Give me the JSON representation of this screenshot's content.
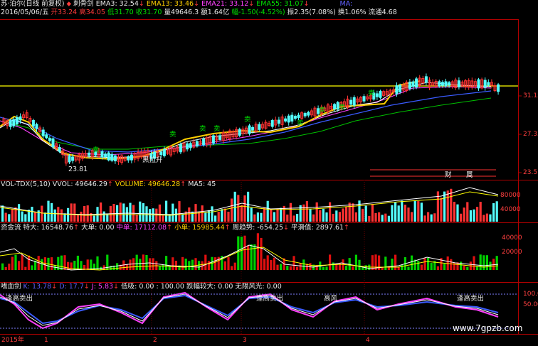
{
  "header": {
    "name": "苏·泊尔(日线 前复权)",
    "ma_label": "刺骨剑",
    "ema3": "EMA3: 32.54",
    "ema13": "EMA13: 33.46",
    "ema21": "EMA21: 33.12",
    "ema55": "EMA55: 31.07",
    "ma": "MA:",
    "date": "2016/05/06/五",
    "open": "开33.24",
    "high": "高34.05",
    "low": "低31.70",
    "close": "收31.70",
    "vol": "量49646.3",
    "amt": "额1.64亿",
    "amp": "幅-1.50(-4.52%)",
    "swing": "振2.35(7.08%)",
    "turn": "换1.06%",
    "float": "流通4.68"
  },
  "main_axis": {
    "ticks": [
      "31.15",
      "27.33",
      "23.51"
    ]
  },
  "main_labels": {
    "low_price": "23.81",
    "inflow": "黑拉升",
    "buy_marks": [
      "卖",
      "卖",
      "卖",
      "卖",
      "卖",
      "卖",
      "卖",
      "卖",
      "卖"
    ],
    "fin": "财",
    "pow": "属"
  },
  "vol_panel": {
    "title": "VOL-TDX(5,10)",
    "vvol": "VVOL: 49646.29",
    "volume": "VOLUME: 49646.28",
    "ma5": "MA5: 45",
    "ticks": [
      "80000",
      "40000"
    ]
  },
  "flow_panel": {
    "title": "资金流",
    "big": "特大: 16548.76",
    "large": "大单: 0.00",
    "mid": "中单: 17112.08",
    "small": "小单: 15985.44",
    "week": "周趋势: -654.25",
    "avg": "平滑值: 2897.61",
    "ticks": [
      "40000",
      "20000"
    ]
  },
  "kdj_panel": {
    "title": "嗜血剑",
    "k": "K: 13.78",
    "d": "D: 17.7",
    "j": "J: 5.83",
    "low": "低吸: 0.00 : 100.00",
    "hint": "跌幅较大: 0.00",
    "wuxian": "无限风光: 0.00",
    "ticks": [
      "100.00",
      "50.00"
    ],
    "marks": [
      "逢高卖出",
      "逢高卖出",
      "逢高卖出",
      "高风"
    ]
  },
  "xaxis": {
    "year": "2015年",
    "months": [
      "1",
      "2",
      "3",
      "4"
    ]
  },
  "watermark": "www.7gpzb.com",
  "colors": {
    "up": "#ff3232",
    "down": "#54ffff",
    "yellow": "#ffff00",
    "white": "#ffffff",
    "magenta": "#ff40ff",
    "blue": "#3a5bff"
  }
}
